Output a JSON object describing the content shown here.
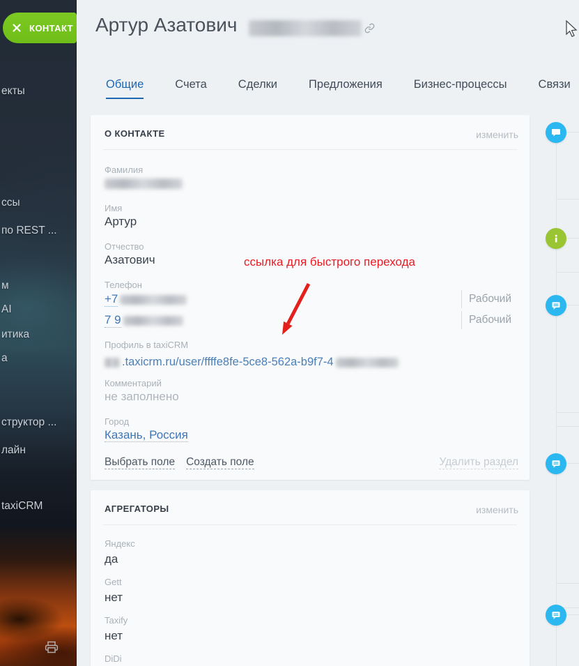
{
  "badge": {
    "label": "КОНТАКТ"
  },
  "sidebar": {
    "items": [
      {
        "label": "екты"
      },
      {
        "label": "ссы"
      },
      {
        "label": "по REST ..."
      },
      {
        "label": "м"
      },
      {
        "label": "AI"
      },
      {
        "label": "итика"
      },
      {
        "label": "а"
      },
      {
        "label": "структор ..."
      },
      {
        "label": "лайн"
      },
      {
        "label": "taxiCRM"
      }
    ]
  },
  "header": {
    "title": "Артур Азатович",
    "lastname_redacted": true
  },
  "tabs": {
    "active_index": 0,
    "items": [
      {
        "label": "Общие"
      },
      {
        "label": "Счета"
      },
      {
        "label": "Сделки"
      },
      {
        "label": "Предложения"
      },
      {
        "label": "Бизнес-процессы"
      },
      {
        "label": "Связи"
      }
    ]
  },
  "annotation": {
    "text": "ссылка для быстрого перехода"
  },
  "about": {
    "title": "О КОНТАКТЕ",
    "edit": "изменить",
    "surname": {
      "label": "Фамилия",
      "redacted": true
    },
    "name": {
      "label": "Имя",
      "value": "Артур"
    },
    "patronymic": {
      "label": "Отчество",
      "value": "Азатович"
    },
    "phone": {
      "label": "Телефон",
      "items": [
        {
          "prefix": "+7",
          "redacted": true,
          "type": "Рабочий"
        },
        {
          "prefix": "7 9",
          "redacted": true,
          "type": "Рабочий"
        }
      ]
    },
    "profile": {
      "label": "Профиль в taxiCRM",
      "visible_url": ".taxicrm.ru/user/ffffe8fe-5ce8-562a-b9f7-4",
      "prefix_redacted": true,
      "suffix_redacted": true
    },
    "comment": {
      "label": "Комментарий",
      "value": "не заполнено"
    },
    "city": {
      "label": "Город",
      "value": "Казань, Россия"
    },
    "actions": {
      "select_field": "Выбрать поле",
      "create_field": "Создать поле",
      "delete_section": "Удалить раздел"
    }
  },
  "aggregators": {
    "title": "АГРЕГАТОРЫ",
    "edit": "изменить",
    "fields": [
      {
        "label": "Яндекс",
        "value": "да"
      },
      {
        "label": "Gett",
        "value": "нет"
      },
      {
        "label": "Taxify",
        "value": "нет"
      },
      {
        "label": "DiDi",
        "value": ""
      }
    ]
  },
  "colors": {
    "accent_green": "#76c21d",
    "tab_active_blue": "#1e67b2",
    "link_blue": "#3e76b5",
    "timeline_blue": "#2bb8f0",
    "timeline_green": "#9ac532",
    "annotation_red": "#e81b23"
  }
}
